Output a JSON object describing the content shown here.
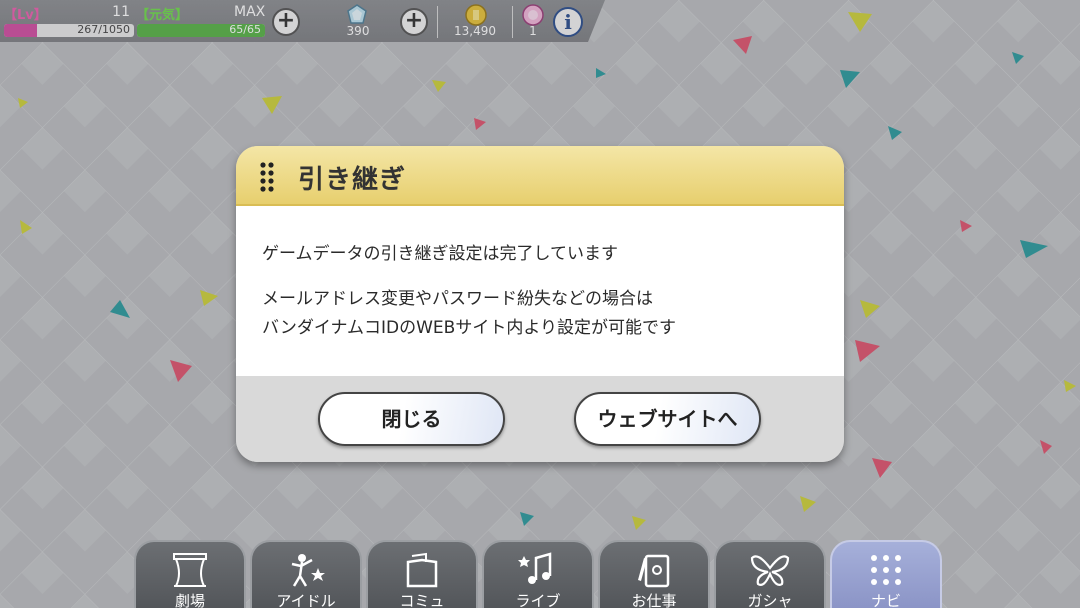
{
  "status_bar": {
    "level_tag": "【Lv】",
    "level": "11",
    "stamina_tag": "【元気】",
    "max_label": "MAX",
    "xp_text": "267/1050",
    "xp_fraction": 0.254,
    "stamina_text": "65/65",
    "stamina_fraction": 1.0,
    "jewels": "390",
    "coins": "13,490",
    "tickets": "1",
    "icons": [
      "plus-icon",
      "jewel-icon",
      "coin-icon",
      "ticket-icon",
      "info-icon"
    ]
  },
  "dialog": {
    "title": "引き継ぎ",
    "line1": "ゲームデータの引き継ぎ設定は完了しています",
    "line2": "メールアドレス変更やパスワード紛失などの場合は",
    "line3": "バンダイナムコIDのWEBサイト内より設定が可能です",
    "close_label": "閉じる",
    "website_label": "ウェブサイトへ"
  },
  "nav": {
    "tabs": [
      {
        "label": "劇場",
        "icon": "theater-icon"
      },
      {
        "label": "アイドル",
        "icon": "idol-icon"
      },
      {
        "label": "コミュ",
        "icon": "commu-icon"
      },
      {
        "label": "ライブ",
        "icon": "live-icon"
      },
      {
        "label": "お仕事",
        "icon": "work-icon"
      },
      {
        "label": "ガシャ",
        "icon": "gacha-icon"
      },
      {
        "label": "ナビ",
        "icon": "navi-icon",
        "active": true
      }
    ]
  },
  "colors": {
    "level_tag": "#ee5fb0",
    "stamina_tag": "#6fdc4b",
    "xp_fill": "#d24fa3",
    "stamina_fill": "#58b447",
    "dialog_header": "#e7cf6e",
    "nav_active": "#8891c4"
  }
}
